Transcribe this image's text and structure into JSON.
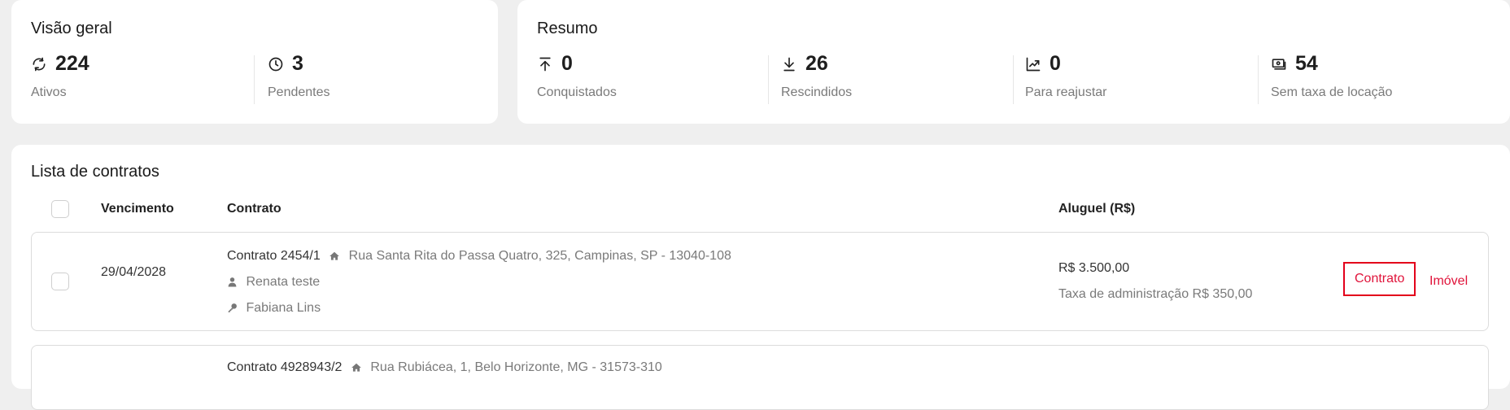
{
  "overview": {
    "title": "Visão geral",
    "stats": [
      {
        "icon": "refresh-icon",
        "value": "224",
        "label": "Ativos"
      },
      {
        "icon": "clock-icon",
        "value": "3",
        "label": "Pendentes"
      }
    ]
  },
  "summary": {
    "title": "Resumo",
    "stats": [
      {
        "icon": "arrow-up-to-line-icon",
        "value": "0",
        "label": "Conquistados"
      },
      {
        "icon": "download-icon",
        "value": "26",
        "label": "Rescindidos"
      },
      {
        "icon": "trending-up-icon",
        "value": "0",
        "label": "Para reajustar"
      },
      {
        "icon": "banknote-icon",
        "value": "54",
        "label": "Sem taxa de locação"
      }
    ]
  },
  "contracts": {
    "title": "Lista de contratos",
    "columns": {
      "due": "Vencimento",
      "contract": "Contrato",
      "rent": "Aluguel (R$)"
    },
    "rows": [
      {
        "due": "29/04/2028",
        "contract": "Contrato 2454/1",
        "address": "Rua Santa Rita do Passa Quatro, 325, Campinas, SP - 13040-108",
        "tenant": "Renata teste",
        "owner": "Fabiana Lins",
        "rent": "R$ 3.500,00",
        "fee": "Taxa de administração R$ 350,00",
        "action_contract": "Contrato",
        "action_property": "Imóvel"
      },
      {
        "contract": "Contrato 4928943/2",
        "address": "Rua Rubiácea, 1, Belo Horizonte, MG - 31573-310"
      }
    ]
  },
  "colors": {
    "accent": "#e0133a",
    "highlight_border": "#e3001b",
    "background": "#efefef"
  }
}
